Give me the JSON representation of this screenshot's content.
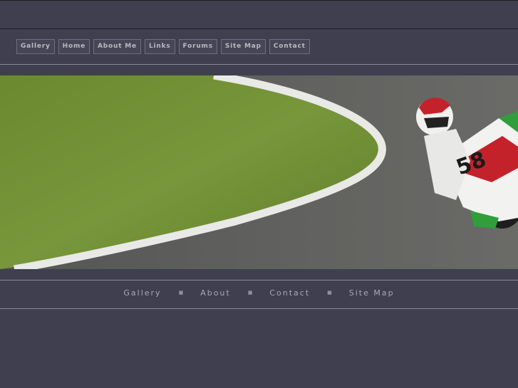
{
  "top_nav": {
    "items": [
      {
        "label": "Gallery"
      },
      {
        "label": "Home"
      },
      {
        "label": "About Me"
      },
      {
        "label": "Links"
      },
      {
        "label": "Forums"
      },
      {
        "label": "Site Map"
      },
      {
        "label": "Contact"
      }
    ]
  },
  "hero": {
    "rider_number": "58"
  },
  "footer_nav": {
    "items": [
      {
        "label": "Gallery"
      },
      {
        "label": "About"
      },
      {
        "label": "Contact"
      },
      {
        "label": "Site Map"
      }
    ],
    "separator": "■"
  },
  "colors": {
    "background": "#403f4f",
    "nav_text": "#b9b9c4",
    "grass": "#6e8c34",
    "track": "#5f5f5c"
  }
}
